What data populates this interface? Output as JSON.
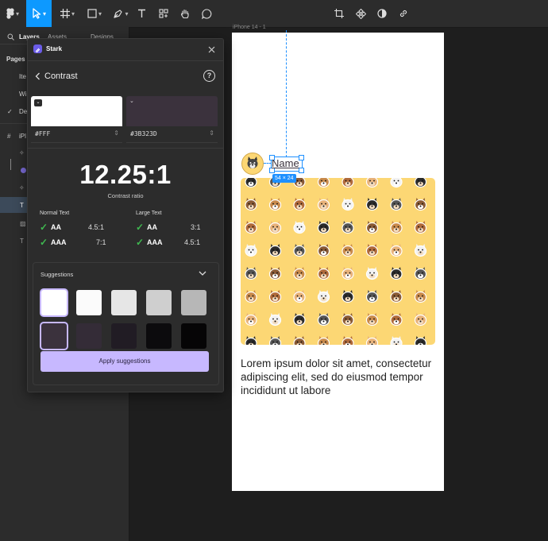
{
  "toolbar": {
    "icons": [
      "figma-menu-icon",
      "move-tool-icon",
      "frame-tool-icon",
      "shape-tool-icon",
      "pen-tool-icon",
      "text-tool-icon",
      "resources-icon",
      "hand-tool-icon",
      "comment-icon",
      "crop-icon",
      "component-icon",
      "contrast-icon",
      "link-icon"
    ],
    "accent": "#0d99ff"
  },
  "left_panel": {
    "tabs": [
      "Layers",
      "Assets",
      "Designs"
    ],
    "pages_label": "Pages",
    "page_items": [
      "Ite",
      "Wi",
      "De"
    ],
    "layer_prefix": "iPl"
  },
  "frame": {
    "label": "iPhone 14 - 1",
    "name_text": "Name",
    "size_badge": "54 × 24",
    "lorem": "Lorem ipsum dolor sit amet, consectetur adipiscing elit, sed do eiusmod tempor incididunt ut labore",
    "pattern_bg": "#fcd774"
  },
  "stark": {
    "title": "Stark",
    "section": "Contrast",
    "fg_hex": "#FFF",
    "bg_hex": "#3B323D",
    "fg_color": "#ffffff",
    "bg_color": "#3b323d",
    "ratio": "12.25:1",
    "ratio_label": "Contrast ratio",
    "normal_text_label": "Normal Text",
    "large_text_label": "Large Text",
    "normal_aa_label": "AA",
    "normal_aa_value": "4.5:1",
    "normal_aaa_label": "AAA",
    "normal_aaa_value": "7:1",
    "large_aa_label": "AA",
    "large_aa_value": "3:1",
    "large_aaa_label": "AAA",
    "large_aaa_value": "4.5:1",
    "suggestions_label": "Suggestions",
    "apply_label": "Apply suggestions",
    "light_swatches": [
      "#ffffff",
      "#fbfbfb",
      "#e6e6e6",
      "#cfcfcf",
      "#b7b7b7"
    ],
    "dark_swatches": [
      "#3b323d",
      "#342c37",
      "#211c24",
      "#0c0b0d",
      "#060506"
    ],
    "button_color": "#c7b8ff"
  }
}
